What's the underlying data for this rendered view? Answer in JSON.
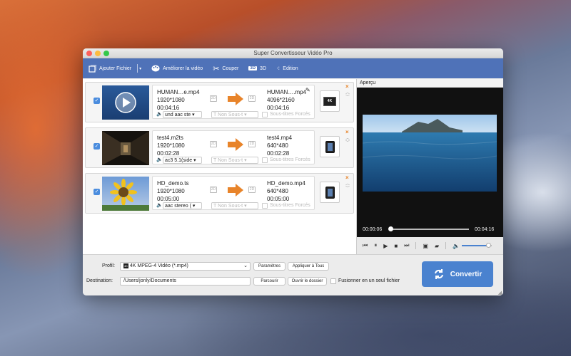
{
  "window": {
    "title": "Super Convertisseur Vidéo Pro"
  },
  "toolbar": {
    "add_file": "Ajouter Fichier",
    "enhance": "Améliorer la vidéo",
    "cut": "Couper",
    "three_d_badge": "3D",
    "three_d": "3D",
    "edit": "Edition"
  },
  "files": [
    {
      "src_name": "HUMAN…e.mp4",
      "src_res": "1920*1080",
      "src_dur": "00:04:16",
      "dst_name": "HUMAN….mp4",
      "dst_res": "4096*2160",
      "dst_dur": "00:04:16",
      "audio": "und aac ste",
      "subtitle": "Non Sous-t",
      "forced_subs": "Sous-titres Forcés",
      "tag_2d": "2D",
      "device_label": "4K"
    },
    {
      "src_name": "test4.m2ts",
      "src_res": "1920*1080",
      "src_dur": "00:02:28",
      "dst_name": "test4.mp4",
      "dst_res": "640*480",
      "dst_dur": "00:02:28",
      "audio": "ac3 5.1(side",
      "subtitle": "Non Sous-t",
      "forced_subs": "Sous-titres Forcés",
      "tag_2d": "2D"
    },
    {
      "src_name": "HD_demo.ts",
      "src_res": "1920*1080",
      "src_dur": "00:05:00",
      "dst_name": "HD_demo.mp4",
      "dst_res": "640*480",
      "dst_dur": "00:05:00",
      "audio": "aac stereo (",
      "subtitle": "Non Sous-t",
      "forced_subs": "Sous-titres Forcés",
      "tag_2d": "2D"
    }
  ],
  "preview": {
    "label": "Aperçu",
    "current_time": "00:00:06",
    "total_time": "00:04:16",
    "progress": 0.02,
    "volume": 0.9
  },
  "bottom": {
    "profile_label": "Profil:",
    "profile_badge": "4K",
    "profile_value": "4K MPEG-4 Vidéo (*.mp4)",
    "settings_btn": "Paramètres",
    "apply_all_btn": "Appliquer à Tous",
    "destination_label": "Destination:",
    "destination_value": "/Users/jonly/Documents",
    "browse_btn": "Parcourir",
    "open_folder_btn": "Ouvrir le dossier",
    "merge_label": "Fusionner en un seul fichier",
    "convert_btn": "Convertir"
  },
  "colors": {
    "accent": "#4f72b8",
    "convert": "#4a82cf",
    "arrow": "#e8842a",
    "checkbox": "#4a8cde"
  }
}
